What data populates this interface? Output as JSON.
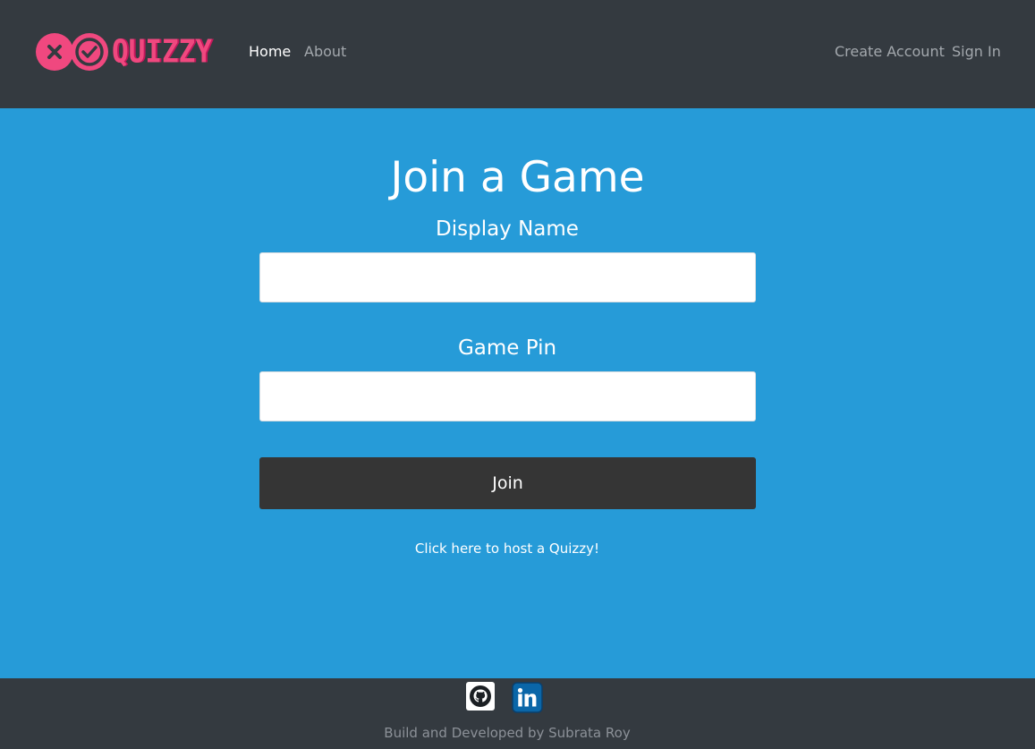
{
  "brand": {
    "logo_text": "QUIZZY",
    "logo_icons": [
      "close-icon",
      "check-icon"
    ],
    "logo_color": "#f0487f"
  },
  "nav": {
    "home": "Home",
    "about": "About",
    "create_account": "Create Account",
    "sign_in": "Sign In"
  },
  "main": {
    "title": "Join a Game",
    "display_name_label": "Display Name",
    "display_name_value": "",
    "game_pin_label": "Game Pin",
    "game_pin_value": "",
    "join_button": "Join",
    "host_link": "Click here to host a Quizzy!"
  },
  "footer": {
    "icons": [
      "github-icon",
      "linkedin-icon"
    ],
    "credit": "Build and Developed by Subrata Roy"
  },
  "colors": {
    "navbar": "#343a40",
    "page_bg": "#269bd8",
    "button": "#353535",
    "nav_active": "#ffffff",
    "nav_inactive": "#a3a8ad"
  }
}
